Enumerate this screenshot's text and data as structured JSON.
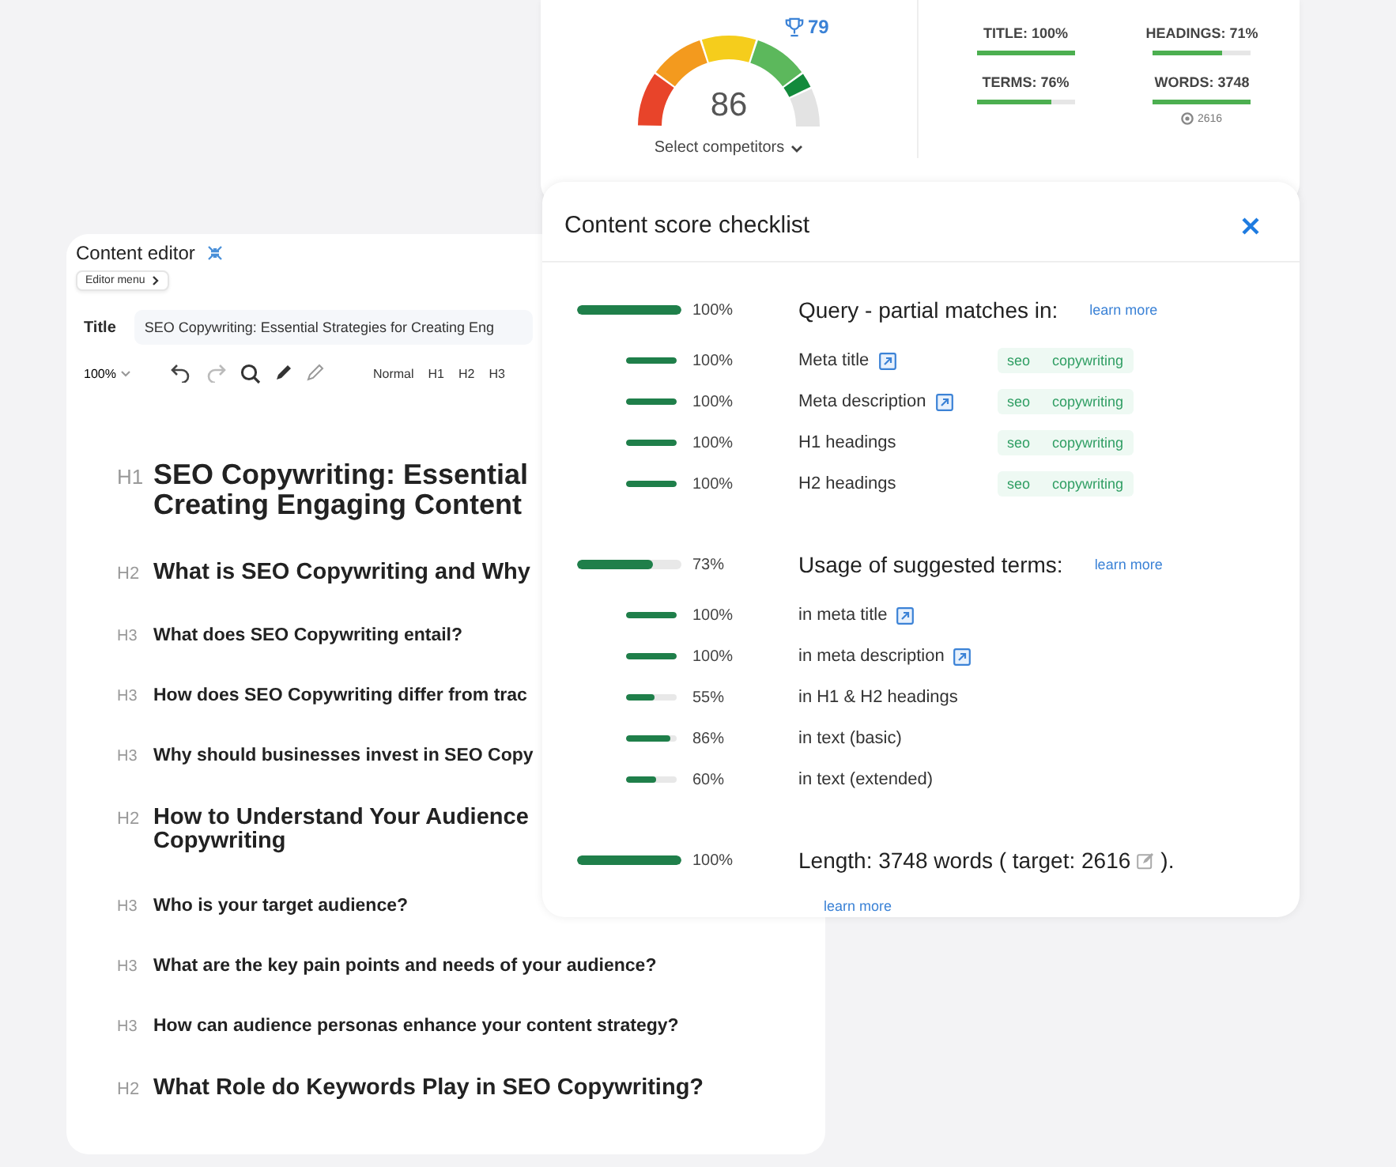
{
  "score_card": {
    "score": "86",
    "level": 0.86,
    "competitor_score": "79",
    "select_label": "Select competitors",
    "metrics": [
      {
        "label": "TITLE: 100%",
        "level": 1
      },
      {
        "label": "HEADINGS: 71%",
        "level": 0.71
      },
      {
        "label": "TERMS: 76%",
        "level": 0.76
      },
      {
        "label": "WORDS: 3748",
        "level": 1,
        "target": "2616"
      }
    ]
  },
  "editor": {
    "title": "Content editor",
    "menu_button": "Editor menu",
    "title_label": "Title",
    "title_value": "SEO Copywriting: Essential Strategies for Creating Eng",
    "toolbar": {
      "zoom": "100%",
      "styles": [
        "Normal",
        "H1",
        "H2",
        "H3"
      ]
    },
    "headings": [
      {
        "tag": "H1",
        "lines": [
          "SEO Copywriting: Essential",
          "Creating Engaging Content"
        ]
      },
      {
        "tag": "H2",
        "lines": [
          "What is SEO Copywriting and Why"
        ]
      },
      {
        "tag": "H3",
        "lines": [
          "What does SEO Copywriting entail?"
        ]
      },
      {
        "tag": "H3",
        "lines": [
          "How does SEO Copywriting differ from trac"
        ]
      },
      {
        "tag": "H3",
        "lines": [
          "Why should businesses invest in SEO Copy"
        ]
      },
      {
        "tag": "H2",
        "lines": [
          "How to Understand Your Audience",
          "Copywriting"
        ]
      },
      {
        "tag": "H3",
        "lines": [
          "Who is your target audience?"
        ]
      },
      {
        "tag": "H3",
        "lines": [
          "What are the key pain points and needs of your audience?"
        ]
      },
      {
        "tag": "H3",
        "lines": [
          "How can audience personas enhance your content strategy?"
        ]
      },
      {
        "tag": "H2",
        "lines": [
          "What Role do Keywords Play in SEO Copywriting?"
        ]
      }
    ]
  },
  "checklist": {
    "title": "Content score checklist",
    "sections": [
      {
        "level": 1,
        "reading": "100%",
        "heading": "Query - partial matches in:",
        "link": "learn more",
        "items": [
          {
            "level": 1,
            "reading": "100%",
            "label": "Meta title",
            "external": true,
            "tags": [
              "seo",
              "copywriting"
            ]
          },
          {
            "level": 1,
            "reading": "100%",
            "label": "Meta description",
            "external": true,
            "tags": [
              "seo",
              "copywriting"
            ]
          },
          {
            "level": 1,
            "reading": "100%",
            "label": "H1 headings",
            "external": false,
            "tags": [
              "seo",
              "copywriting"
            ]
          },
          {
            "level": 1,
            "reading": "100%",
            "label": "H2 headings",
            "external": false,
            "tags": [
              "seo",
              "copywriting"
            ]
          }
        ]
      },
      {
        "level": 0.73,
        "reading": "73%",
        "heading": "Usage of suggested terms:",
        "link": "learn more",
        "items": [
          {
            "level": 1,
            "reading": "100%",
            "label": "in meta title",
            "external": true
          },
          {
            "level": 1,
            "reading": "100%",
            "label": "in meta description",
            "external": true
          },
          {
            "level": 0.55,
            "reading": "55%",
            "label": "in H1 & H2 headings",
            "external": false
          },
          {
            "level": 0.86,
            "reading": "86%",
            "label": "in text (basic)",
            "external": false
          },
          {
            "level": 0.6,
            "reading": "60%",
            "label": "in text (extended)",
            "external": false
          }
        ]
      },
      {
        "level": 1,
        "reading": "100%",
        "heading": "Length: 3748 words ( target: 2616",
        "heading_end": ").",
        "editable": true,
        "link": "learn more",
        "link_below": true
      }
    ]
  }
}
